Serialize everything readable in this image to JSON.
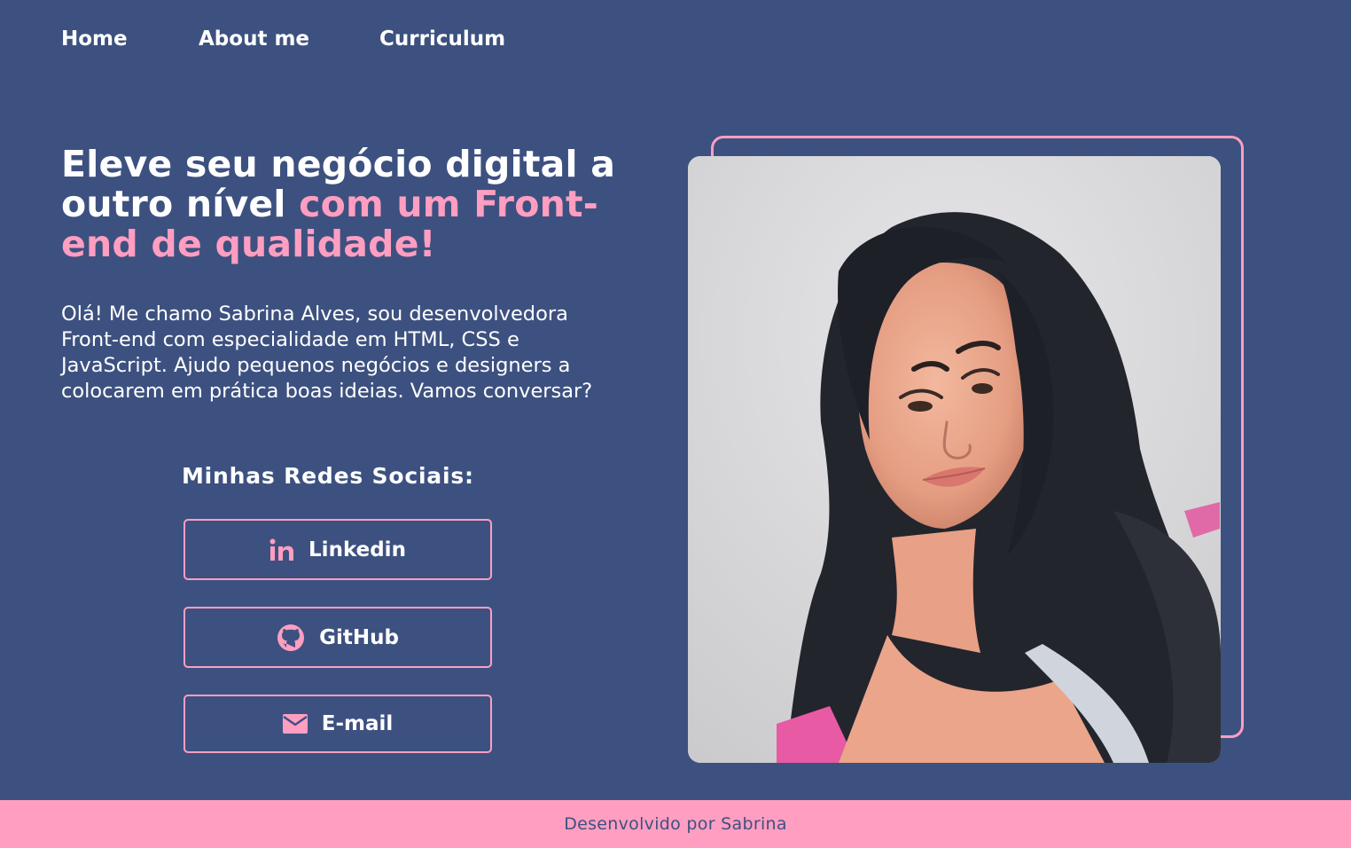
{
  "nav": {
    "items": [
      {
        "label": "Home"
      },
      {
        "label": "About me"
      },
      {
        "label": "Curriculum"
      }
    ]
  },
  "hero": {
    "title_white": "Eleve seu negócio digital a outro nível",
    "title_accent": "com um Front-end de qualidade!",
    "intro": "Olá! Me chamo Sabrina Alves, sou desenvolvedora Front-end com especialidade em HTML, CSS e JavaScript. Ajudo pequenos negócios e designers a colocarem em prática boas ideias. Vamos conversar?"
  },
  "social": {
    "title": "Minhas Redes Sociais:",
    "buttons": [
      {
        "label": "Linkedin",
        "icon": "linkedin-icon"
      },
      {
        "label": "GitHub",
        "icon": "github-icon"
      },
      {
        "label": "E-mail",
        "icon": "mail-icon"
      }
    ]
  },
  "footer": {
    "text": "Desenvolvido por Sabrina"
  },
  "colors": {
    "background": "#3d5180",
    "accent": "#ff9ec1",
    "text": "#ffffff"
  }
}
